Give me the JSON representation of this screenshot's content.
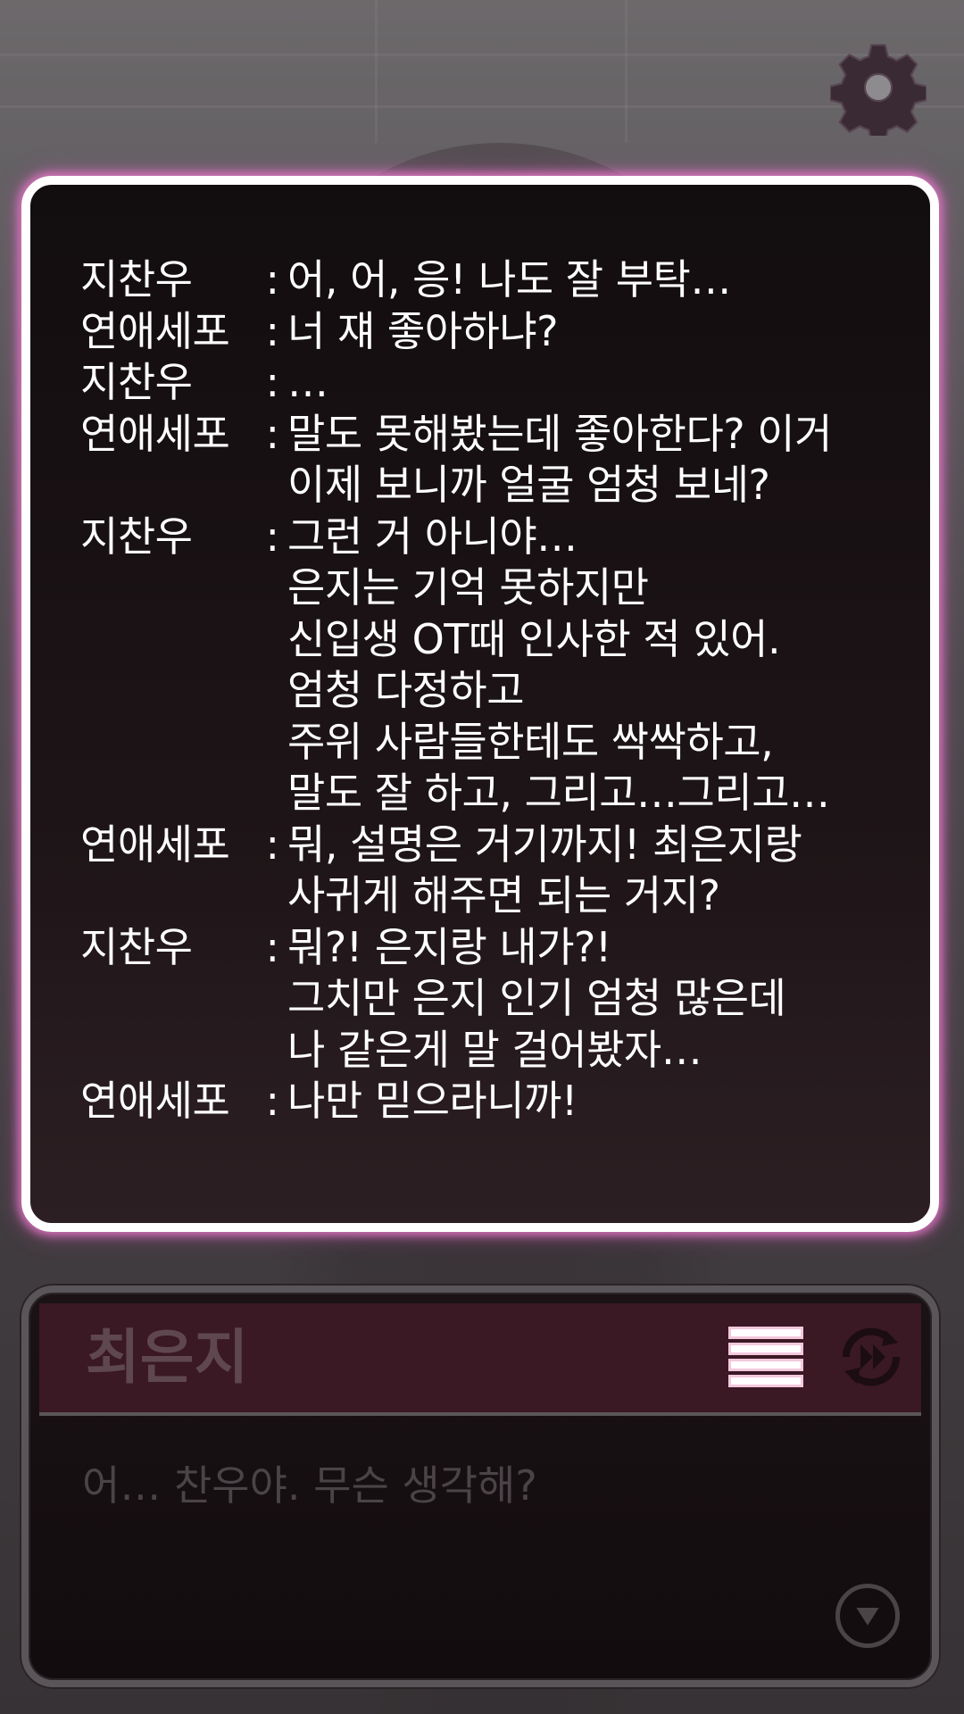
{
  "settings": {
    "icon": "gear-icon",
    "color": "#3a2a33"
  },
  "backlog": {
    "entries": [
      {
        "speaker": "지찬우",
        "colon": ":",
        "lines": [
          "어, 어, 응! 나도 잘 부탁…"
        ]
      },
      {
        "speaker": "연애세포",
        "colon": ":",
        "lines": [
          "너 쟤 좋아하냐?"
        ]
      },
      {
        "speaker": "지찬우",
        "colon": ":",
        "lines": [
          "…"
        ]
      },
      {
        "speaker": "연애세포",
        "colon": ":",
        "lines": [
          "말도 못해봤는데 좋아한다? 이거",
          "이제 보니까 얼굴 엄청 보네?"
        ]
      },
      {
        "speaker": "지찬우",
        "colon": ":",
        "lines": [
          "그런 거 아니야…",
          "은지는 기억 못하지만",
          "신입생 OT때 인사한 적 있어.",
          "엄청 다정하고",
          "주위 사람들한테도 싹싹하고,",
          "말도 잘 하고, 그리고…그리고…"
        ]
      },
      {
        "speaker": "연애세포",
        "colon": ":",
        "lines": [
          "뭐, 설명은 거기까지! 최은지랑",
          "사귀게 해주면 되는 거지?"
        ]
      },
      {
        "speaker": "지찬우",
        "colon": ":",
        "lines": [
          "뭐?! 은지랑 내가?!",
          "그치만 은지 인기 엄청 많은데",
          "나 같은게 말 걸어봤자…"
        ]
      },
      {
        "speaker": "연애세포",
        "colon": ":",
        "lines": [
          "나만 믿으라니까!"
        ]
      }
    ]
  },
  "dialog": {
    "speaker": "최은지",
    "text": "어… 찬우야. 무슨 생각해?",
    "menu_icon": "menu-icon",
    "auto_icon": "auto-play-icon",
    "next_icon": "next-arrow-icon"
  },
  "colors": {
    "panel_glow": "#e678c8",
    "panel_border": "#ffffff",
    "name_bar": "#3a1824"
  }
}
